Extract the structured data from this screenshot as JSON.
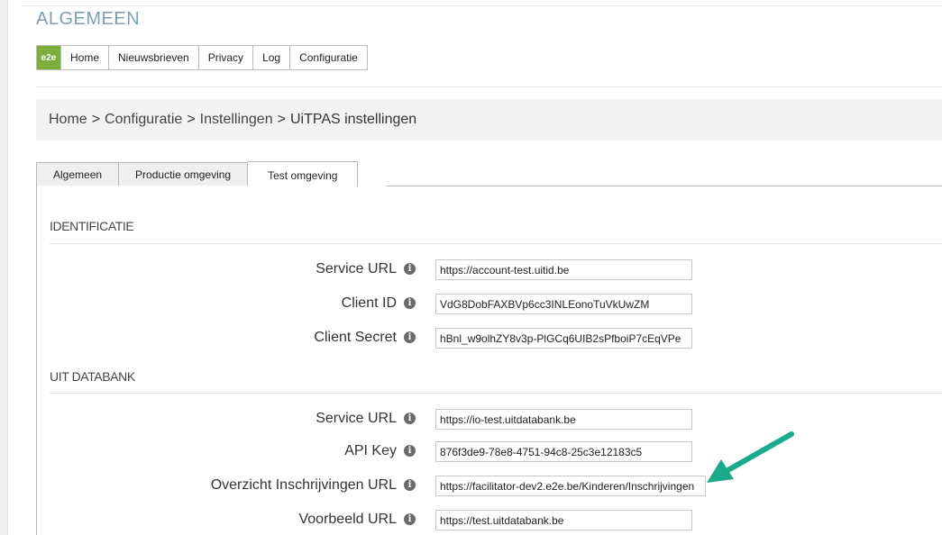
{
  "app": {
    "title": "ALGEMEEN",
    "logo_text": "e2e"
  },
  "menu": {
    "items": [
      {
        "label": "Home"
      },
      {
        "label": "Nieuwsbrieven"
      },
      {
        "label": "Privacy"
      },
      {
        "label": "Log"
      },
      {
        "label": "Configuratie"
      }
    ]
  },
  "breadcrumb": {
    "items": [
      "Home",
      "Configuratie",
      "Instellingen",
      "UiTPAS instellingen"
    ],
    "separator": ">"
  },
  "tabs": [
    {
      "label": "Algemeen"
    },
    {
      "label": "Productie omgeving"
    },
    {
      "label": "Test omgeving",
      "active": true
    }
  ],
  "identificatie": {
    "heading": "IDENTIFICATIE",
    "fields": [
      {
        "label": "Service URL",
        "value": "https://account-test.uitid.be"
      },
      {
        "label": "Client ID",
        "value": "VdG8DobFAXBVp6cc3INLEonoTuVkUwZM"
      },
      {
        "label": "Client Secret",
        "value": "hBnl_w9olhZY8v3p-PlGCq6UIB2sPfboiP7cEqVPe"
      }
    ]
  },
  "uit_databank": {
    "heading": "UIT DATABANK",
    "fields": [
      {
        "label": "Service URL",
        "value": "https://io-test.uitdatabank.be"
      },
      {
        "label": "API Key",
        "value": "876f3de9-78e8-4751-94c8-25c3e12183c5"
      },
      {
        "label": "Overzicht Inschrijvingen URL",
        "value": "https://facilitator-dev2.e2e.be/Kinderen/Inschrijvingen"
      },
      {
        "label": "Voorbeeld URL",
        "value": "https://test.uitdatabank.be"
      }
    ]
  },
  "info_icon_glyph": "i",
  "colors": {
    "arrow": "#1aaa8c",
    "accent_title": "#7aa0b0",
    "logo_bg": "#7cae3e"
  }
}
